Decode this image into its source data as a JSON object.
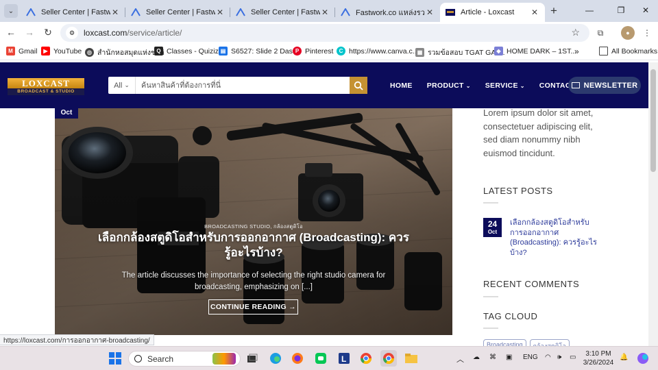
{
  "browser": {
    "tabs": [
      {
        "title": "Seller Center | Fastwork.c",
        "active": false
      },
      {
        "title": "Seller Center | Fastwork.c",
        "active": false
      },
      {
        "title": "Seller Center | Fastwork.c",
        "active": false
      },
      {
        "title": "Fastwork.co แหล่งรวมฟรีแล",
        "active": false
      },
      {
        "title": "Article - Loxcast",
        "active": true
      }
    ],
    "url_host": "loxcast.com",
    "url_path": "/service/article/",
    "bookmarks": [
      {
        "label": "Gmail",
        "icon": "gmail-icon",
        "color": "#ea4335"
      },
      {
        "label": "YouTube",
        "icon": "youtube-icon",
        "color": "#ff0000"
      },
      {
        "label": "สำนักหอสมุดแห่งชาติ",
        "icon": "globe-icon",
        "color": "#444444"
      },
      {
        "label": "Classes - Quizizz",
        "icon": "quizizz-icon",
        "color": "#222222"
      },
      {
        "label": "S6527: Slide 2 Das...",
        "icon": "slides-icon",
        "color": "#1a73e8"
      },
      {
        "label": "Pinterest",
        "icon": "pinterest-icon",
        "color": "#e60023"
      },
      {
        "label": "https://www.canva.c...",
        "icon": "canva-icon",
        "color": "#00c4cc"
      },
      {
        "label": "รวมข้อสอบ TGAT GAT...",
        "icon": "doc-icon",
        "color": "#888888"
      },
      {
        "label": "HOME DARK – 1ST...",
        "icon": "home-site-icon",
        "color": "#7b7fd6"
      }
    ],
    "all_bookmarks": "All Bookmarks",
    "status_url": "https://loxcast.com/การออกอากาศ-broadcasting/"
  },
  "site": {
    "logo_top": "LOXCAST",
    "logo_bottom": "BROADCAST & STUDIO",
    "search_category": "All",
    "search_placeholder": "ค้นหาสินค้าที่ต้องการที่นี่",
    "nav": [
      {
        "label": "HOME",
        "dropdown": false
      },
      {
        "label": "PRODUCT",
        "dropdown": true
      },
      {
        "label": "SERVICE",
        "dropdown": true
      },
      {
        "label": "CONTACT",
        "dropdown": false
      }
    ],
    "newsletter": "NEWSLETTER",
    "accent": "#c59233",
    "brand": "#0c0c5a"
  },
  "article": {
    "date_month": "Oct",
    "categories": "BROADCASTING STUDIO, กล้องสตูดิโอ",
    "title": "เลือกกล้องสตูดิโอสำหรับการออกอากาศ (Broadcasting): ควรรู้อะไรบ้าง?",
    "excerpt": "The article discusses the importance of selecting the right studio camera for broadcasting, emphasizing on [...]",
    "cta": "CONTINUE READING →"
  },
  "sidebar": {
    "lorem": "Lorem ipsum dolor sit amet, consectetuer adipiscing elit, sed diam nonummy nibh euismod tincidunt.",
    "latest_posts_title": "LATEST POSTS",
    "latest_post": {
      "day": "24",
      "month": "Oct",
      "title": "เลือกกล้องสตูดิโอสำหรับการออกอากาศ (Broadcasting): ควรรู้อะไรบ้าง?"
    },
    "recent_comments_title": "RECENT COMMENTS",
    "tag_cloud_title": "TAG CLOUD",
    "tags": [
      "Broadcasting",
      "กล้องสตูดิโอ"
    ]
  },
  "taskbar": {
    "search": "Search",
    "lang": "ENG",
    "time": "3:10 PM",
    "date": "3/26/2024"
  }
}
